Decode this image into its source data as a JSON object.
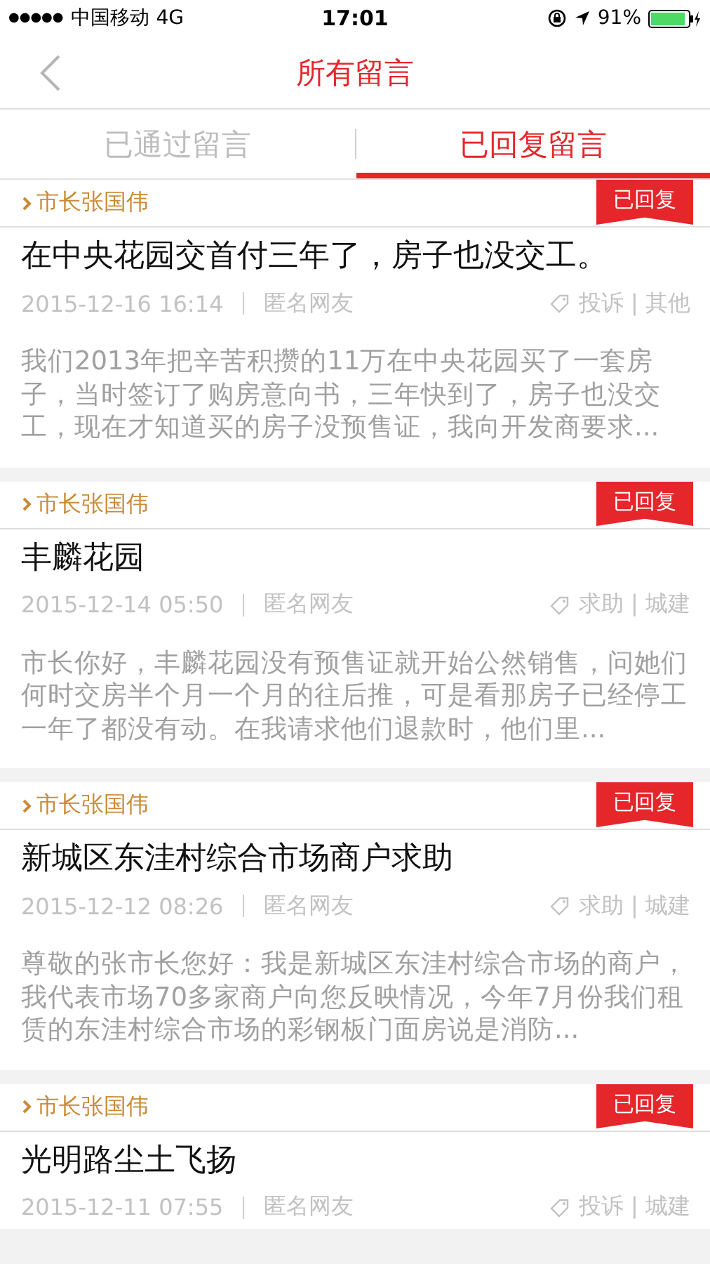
{
  "status_bar": {
    "signal": "●●●●●",
    "carrier": "中国移动",
    "network": "4G",
    "time": "17:01",
    "battery": "91%"
  },
  "nav": {
    "title": "所有留言"
  },
  "tabs": [
    {
      "label": "已通过留言",
      "selected": false
    },
    {
      "label": "已回复留言",
      "selected": true
    }
  ],
  "messages": [
    {
      "recipient": "市长张国伟",
      "badge": "已回复",
      "title": "在中央花园交首付三年了，房子也没交工。",
      "date": "2015-12-16 16:14",
      "author": "匿名网友",
      "category": "投诉 | 其他",
      "excerpt": "我们2013年把辛苦积攒的11万在中央花园买了一套房子，当时签订了购房意向书，三年快到了，房子也没交工，现在才知道买的房子没预售证，我向开发商要求..."
    },
    {
      "recipient": "市长张国伟",
      "badge": "已回复",
      "title": "丰麟花园",
      "date": "2015-12-14 05:50",
      "author": "匿名网友",
      "category": "求助 | 城建",
      "excerpt": "市长你好，丰麟花园没有预售证就开始公然销售，问她们何时交房半个月一个月的往后推，可是看那房子已经停工一年了都没有动。在我请求他们退款时，他们里..."
    },
    {
      "recipient": "市长张国伟",
      "badge": "已回复",
      "title": "新城区东洼村综合市场商户求助",
      "date": "2015-12-12 08:26",
      "author": "匿名网友",
      "category": "求助 | 城建",
      "excerpt": "尊敬的张市长您好：我是新城区东洼村综合市场的商户，我代表市场70多家商户向您反映情况，今年7月份我们租赁的东洼村综合市场的彩钢板门面房说是消防..."
    },
    {
      "recipient": "市长张国伟",
      "badge": "已回复",
      "title": "光明路尘土飞扬",
      "date": "2015-12-11 07:55",
      "author": "匿名网友",
      "category": "投诉 | 城建"
    }
  ]
}
